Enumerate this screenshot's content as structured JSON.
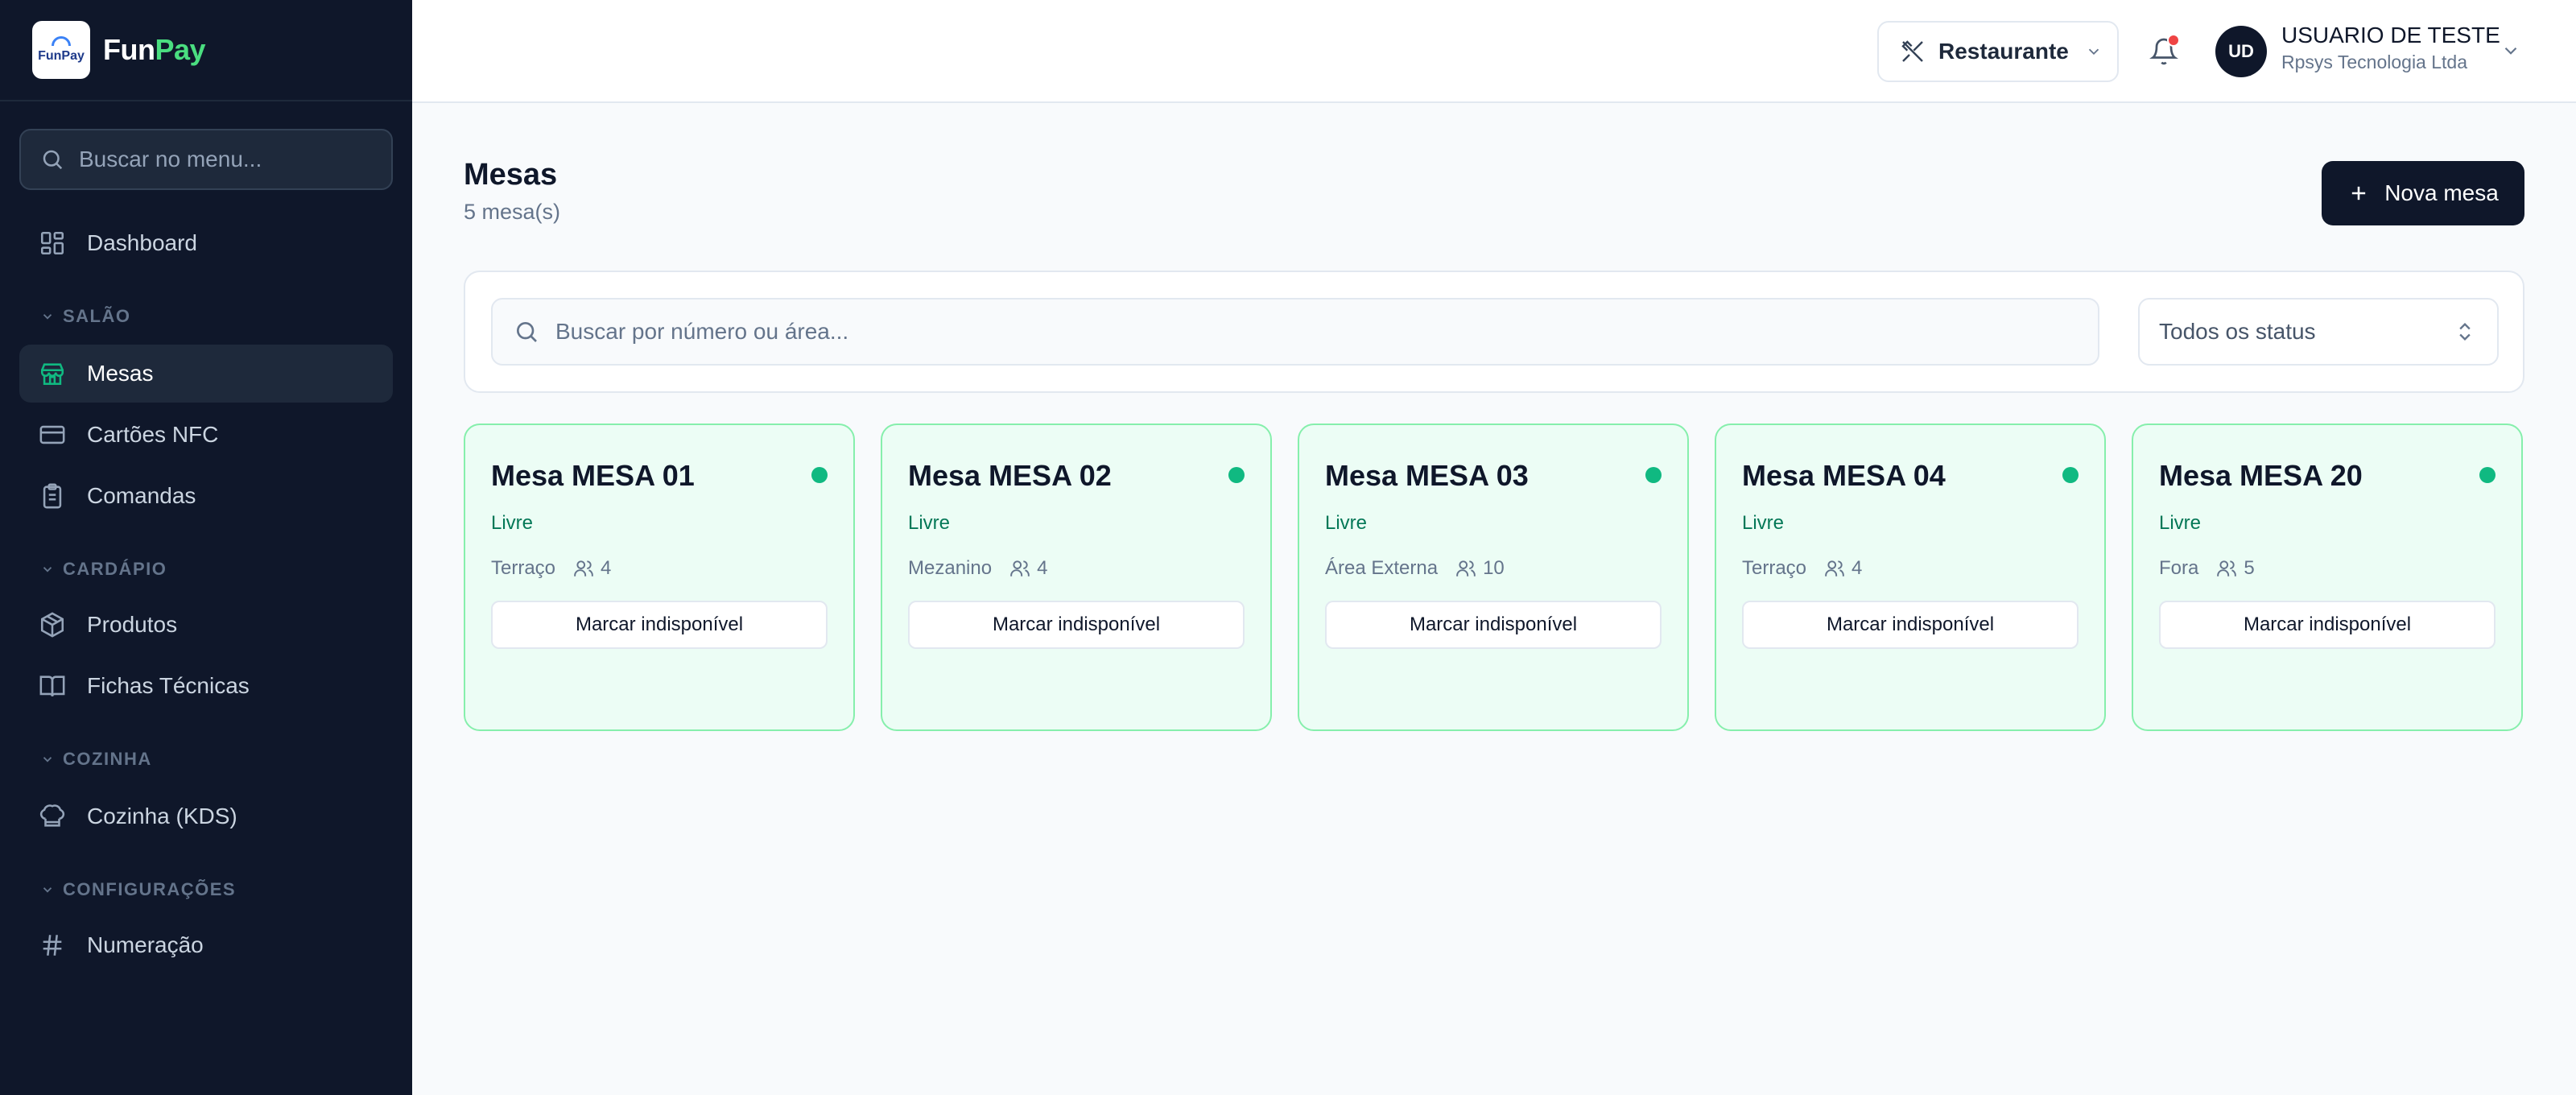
{
  "brand": {
    "prefix": "Fun",
    "suffix": "Pay",
    "logo_text": "FunPay"
  },
  "sidebar": {
    "search_placeholder": "Buscar no menu...",
    "items": [
      {
        "label": "Dashboard",
        "icon": "dashboard-icon"
      },
      {
        "label": "Mesas",
        "icon": "store-icon",
        "active": true
      },
      {
        "label": "Cartões NFC",
        "icon": "credit-card-icon"
      },
      {
        "label": "Comandas",
        "icon": "clipboard-icon"
      },
      {
        "label": "Produtos",
        "icon": "package-icon"
      },
      {
        "label": "Fichas Técnicas",
        "icon": "book-icon"
      },
      {
        "label": "Cozinha (KDS)",
        "icon": "chef-hat-icon"
      },
      {
        "label": "Numeração",
        "icon": "hash-icon"
      }
    ],
    "sections": [
      "SALÃO",
      "CARDÁPIO",
      "COZINHA",
      "CONFIGURAÇÕES"
    ]
  },
  "topbar": {
    "mode_label": "Restaurante",
    "user": {
      "initials": "UD",
      "name": "USUARIO DE TESTE",
      "company": "Rpsys Tecnologia Ltda"
    }
  },
  "page": {
    "title": "Mesas",
    "subtitle": "5 mesa(s)",
    "new_button_label": "Nova mesa",
    "search_placeholder": "Buscar por número ou área...",
    "status_filter": "Todos os status"
  },
  "tables": [
    {
      "title": "Mesa MESA 01",
      "status": "Livre",
      "area": "Terraço",
      "capacity": "4",
      "action": "Marcar indisponível"
    },
    {
      "title": "Mesa MESA 02",
      "status": "Livre",
      "area": "Mezanino",
      "capacity": "4",
      "action": "Marcar indisponível"
    },
    {
      "title": "Mesa MESA 03",
      "status": "Livre",
      "area": "Área Externa",
      "capacity": "10",
      "action": "Marcar indisponível"
    },
    {
      "title": "Mesa MESA 04",
      "status": "Livre",
      "area": "Terraço",
      "capacity": "4",
      "action": "Marcar indisponível"
    },
    {
      "title": "Mesa MESA 20",
      "status": "Livre",
      "area": "Fora",
      "capacity": "5",
      "action": "Marcar indisponível"
    }
  ],
  "colors": {
    "sidebar_bg": "#0f172a",
    "accent_green": "#10b981",
    "card_bg": "#ecfdf5",
    "card_border": "#86efac",
    "primary_button": "#0f172a",
    "notification_dot": "#ef4444"
  }
}
